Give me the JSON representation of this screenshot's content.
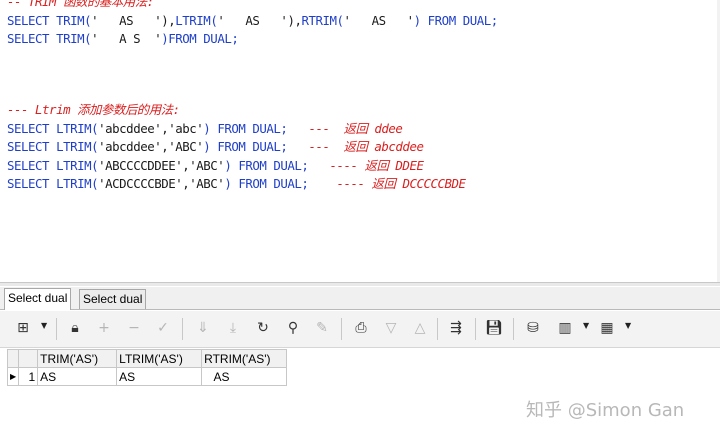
{
  "editor": {
    "lines": [
      {
        "parts": [
          {
            "t": "-- TRIM 函数的基本用法:",
            "k": "cm"
          }
        ]
      },
      {
        "parts": [
          {
            "t": "SELECT TRIM(",
            "k": "kw"
          },
          {
            "t": "'   AS   '",
            "k": "str"
          },
          {
            "t": "),",
            "k": "p"
          },
          {
            "t": "LTRIM(",
            "k": "kw"
          },
          {
            "t": "'   AS   '",
            "k": "str"
          },
          {
            "t": "),",
            "k": "p"
          },
          {
            "t": "RTRIM(",
            "k": "kw"
          },
          {
            "t": "'   AS   '",
            "k": "str"
          },
          {
            "t": ") FROM DUAL;",
            "k": "kw"
          }
        ]
      },
      {
        "parts": [
          {
            "t": "SELECT TRIM(",
            "k": "kw"
          },
          {
            "t": "'   A S  '",
            "k": "str"
          },
          {
            "t": ")FROM DUAL;",
            "k": "kw"
          }
        ]
      },
      {
        "parts": []
      },
      {
        "parts": []
      },
      {
        "parts": [
          {
            "t": "--- Ltrim 添加参数后的用法:",
            "k": "cm"
          }
        ]
      },
      {
        "parts": [
          {
            "t": "SELECT LTRIM(",
            "k": "kw"
          },
          {
            "t": "'abcddee','abc'",
            "k": "str"
          },
          {
            "t": ") FROM DUAL;   ",
            "k": "kw"
          },
          {
            "t": "---  返回 ddee",
            "k": "cm"
          }
        ]
      },
      {
        "parts": [
          {
            "t": "SELECT LTRIM(",
            "k": "kw"
          },
          {
            "t": "'abcddee','ABC'",
            "k": "str"
          },
          {
            "t": ") FROM DUAL;   ",
            "k": "kw"
          },
          {
            "t": "---  返回 abcddee",
            "k": "cm"
          }
        ]
      },
      {
        "parts": [
          {
            "t": "SELECT LTRIM(",
            "k": "kw"
          },
          {
            "t": "'ABCCCCDDEE','ABC'",
            "k": "str"
          },
          {
            "t": ") FROM DUAL;   ",
            "k": "kw"
          },
          {
            "t": "---- 返回 DDEE",
            "k": "cm"
          }
        ]
      },
      {
        "parts": [
          {
            "t": "SELECT LTRIM(",
            "k": "kw"
          },
          {
            "t": "'ACDCCCCBDE','ABC'",
            "k": "str"
          },
          {
            "t": ") FROM DUAL;    ",
            "k": "kw"
          },
          {
            "t": "---- 返回 DCCCCCBDE",
            "k": "cm"
          }
        ]
      }
    ]
  },
  "tabs": [
    "Select dual",
    "Select dual"
  ],
  "toolbar": {
    "icons": [
      "grid-view-icon",
      "dropdown-arrow-icon",
      "lock-icon",
      "add-row-icon",
      "delete-row-icon",
      "post-changes-icon",
      "next-page-icon",
      "last-page-icon",
      "refresh-icon",
      "find-icon",
      "clear-icon",
      "print-icon",
      "move-down-icon",
      "move-up-icon",
      "query-by-example-icon",
      "save-icon",
      "export-icon",
      "chart-icon",
      "dropdown-arrow-icon",
      "table-icon",
      "dropdown-arrow-icon"
    ]
  },
  "grid": {
    "columns": [
      "TRIM('AS')",
      "LTRIM('AS')",
      "RTRIM('AS')"
    ],
    "rows": [
      {
        "num": "1",
        "cells": [
          "AS",
          "AS",
          "   AS"
        ]
      }
    ]
  },
  "watermark": "知乎 @Simon Gan"
}
